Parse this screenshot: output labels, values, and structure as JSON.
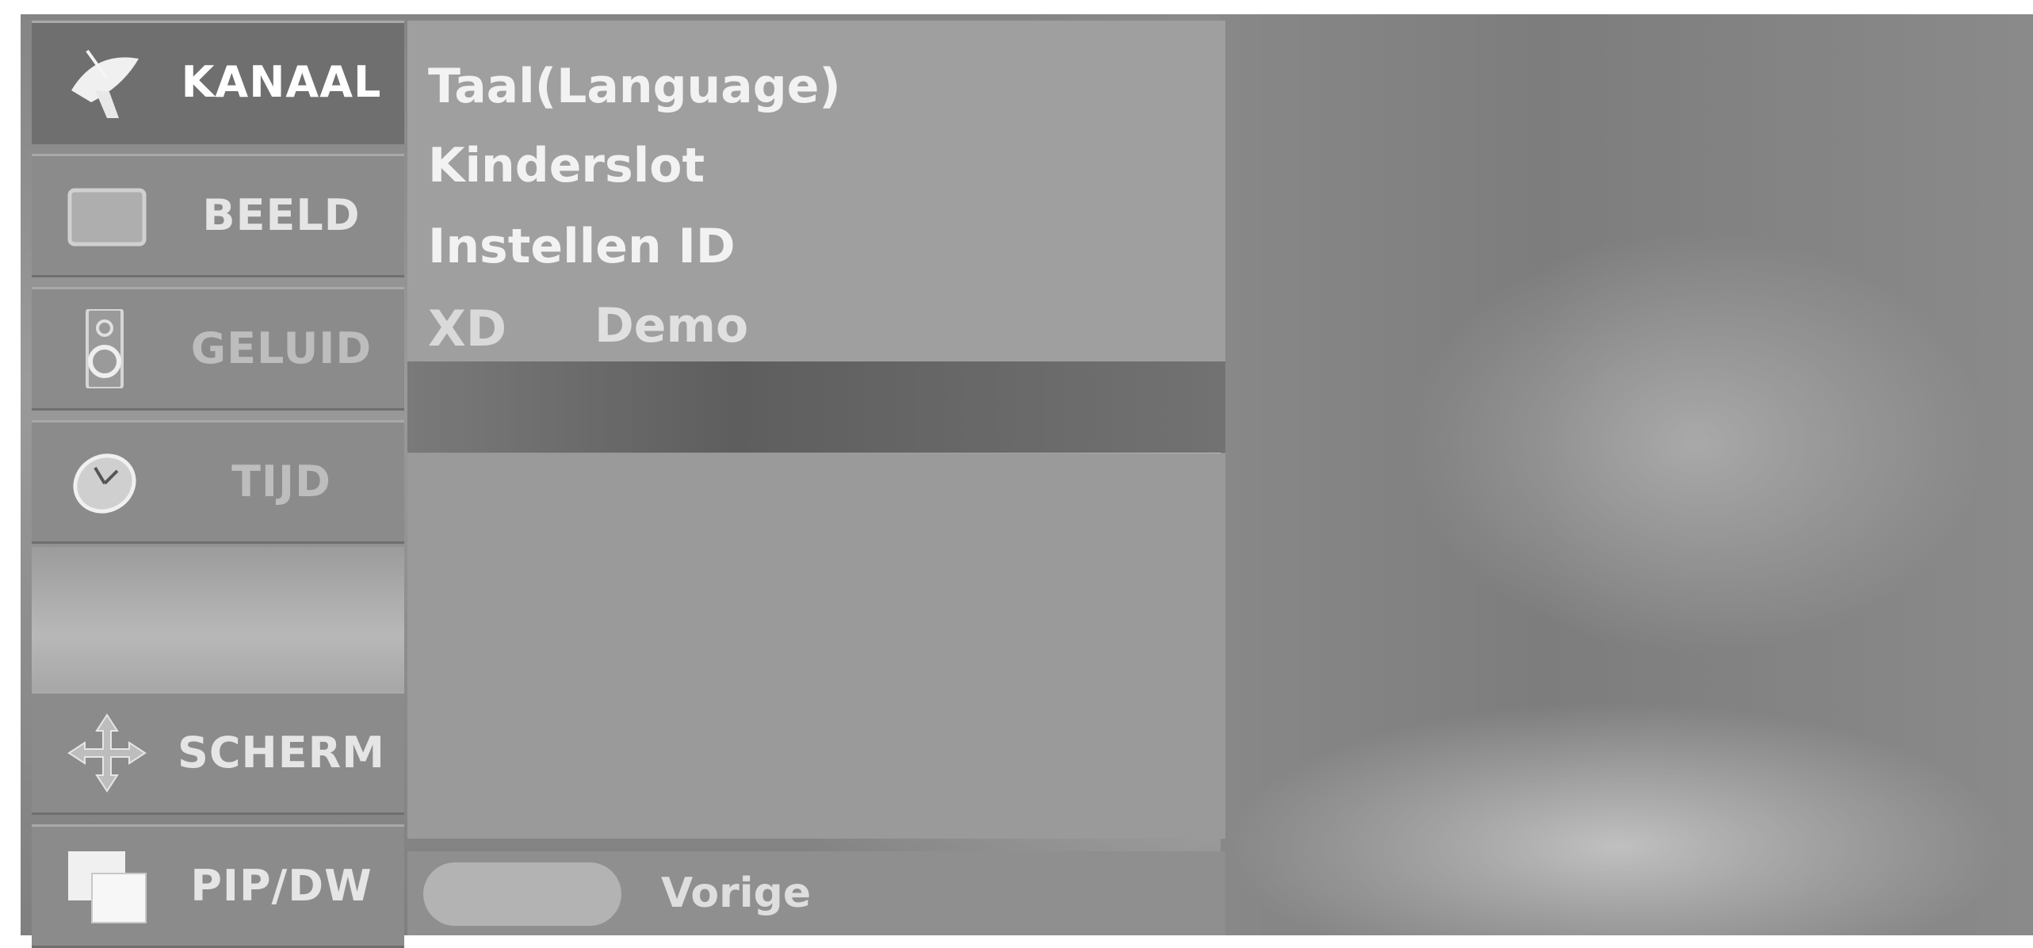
{
  "main_menu": {
    "items": [
      {
        "label": "KANAAL",
        "icon": "satellite-dish-icon",
        "state": "selected"
      },
      {
        "label": "BEELD",
        "icon": "tv-screen-icon",
        "state": "normal"
      },
      {
        "label": "GELUID",
        "icon": "speaker-icon",
        "state": "dimmed"
      },
      {
        "label": "TIJD",
        "icon": "clock-icon",
        "state": "dimmed"
      },
      {
        "label": "SCHERM",
        "icon": "move-arrows-icon",
        "state": "normal"
      },
      {
        "label": "PIP/DW",
        "icon": "pip-windows-icon",
        "state": "normal"
      }
    ]
  },
  "submenu": {
    "items": [
      {
        "label": "Taal(Language)"
      },
      {
        "label": "Kinderslot"
      },
      {
        "label": "Instellen ID"
      },
      {
        "label": "Demo",
        "logo_text": "XD"
      }
    ]
  },
  "footer": {
    "prev_label": "Vorige"
  },
  "colors": {
    "menu_bg": "#8b8b8b",
    "menu_selected_bg": "#6f6f6f",
    "submenu_bg": "#9f9f9f"
  }
}
